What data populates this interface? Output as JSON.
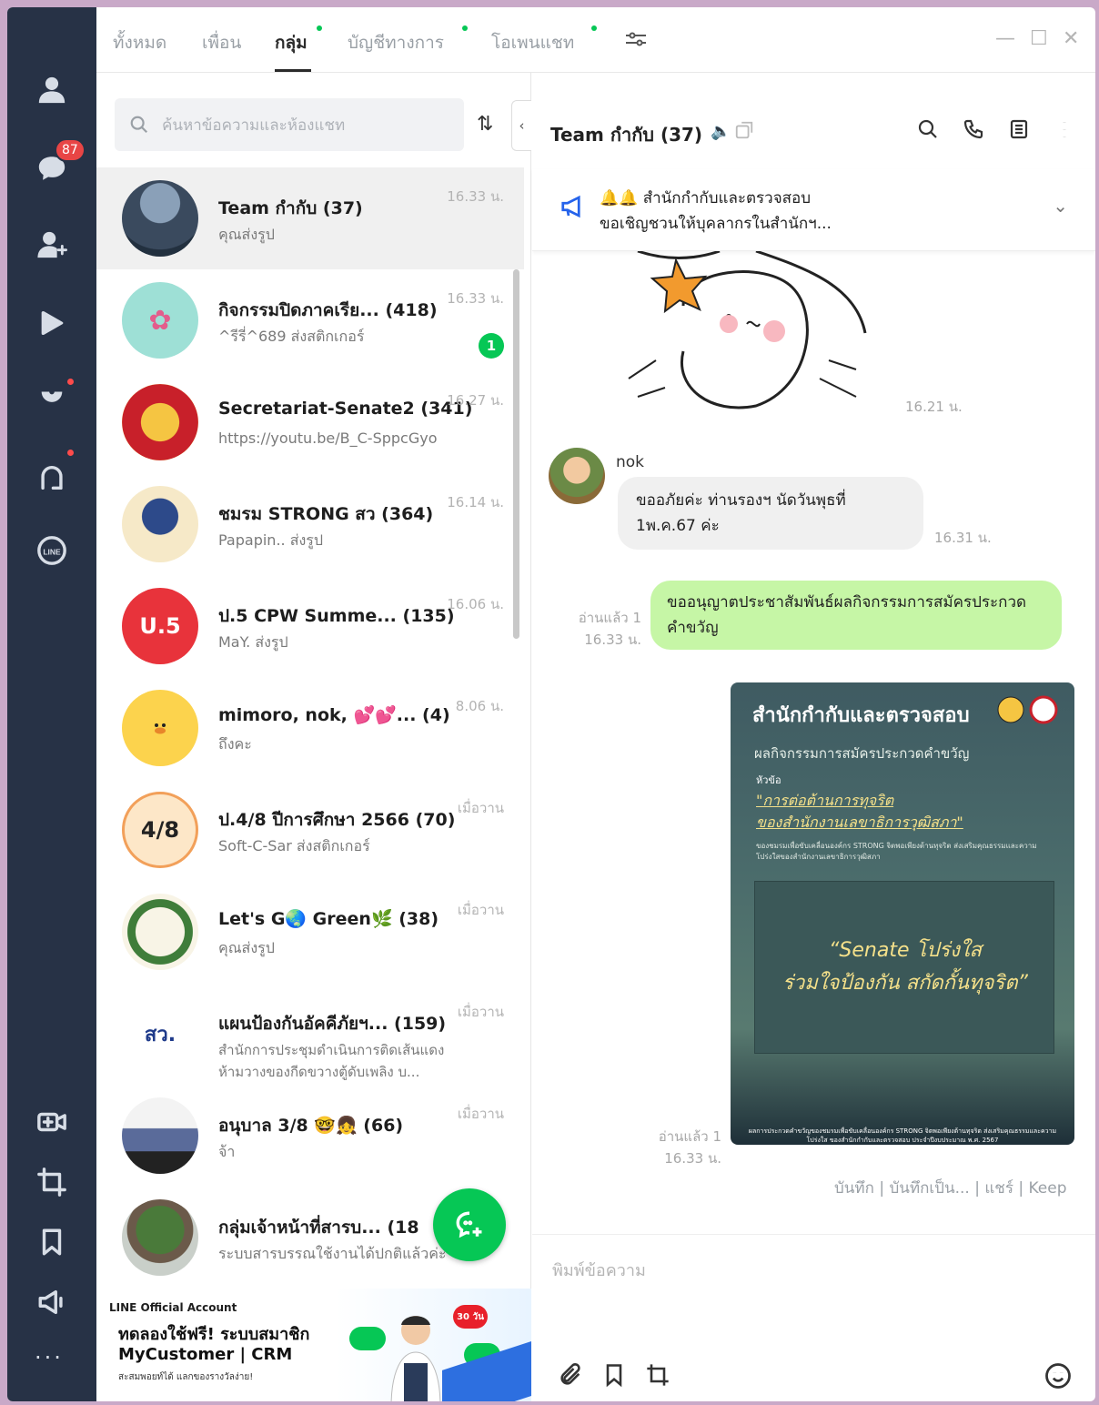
{
  "tabs": [
    {
      "label": "ทั้งหมด"
    },
    {
      "label": "เพื่อน"
    },
    {
      "label": "กลุ่ม"
    },
    {
      "label": "บัญชีทางการ"
    },
    {
      "label": "โอเพนแชท"
    }
  ],
  "nav": {
    "chat_badge": "87"
  },
  "search": {
    "placeholder": "ค้นหาข้อความและห้องแชท"
  },
  "chats": [
    {
      "name": "Team กำกับ (37)",
      "preview": "คุณส่งรูป",
      "time": "16.33 น."
    },
    {
      "name": "กิจกรรมปิดภาคเรีย... (418)",
      "preview": "^รีรี่^689 ส่งสติกเกอร์",
      "time": "16.33 น.",
      "unread": "1"
    },
    {
      "name": "Secretariat-Senate2 (341)",
      "preview": "https://youtu.be/B_C-SppcGyo",
      "time": "16.27 น."
    },
    {
      "name": "ชมรม STRONG สว (364)",
      "preview": "Papapin.. ส่งรูป",
      "time": "16.14 น."
    },
    {
      "name": "ป.5 CPW Summe... (135)",
      "preview": "MaY. ส่งรูป",
      "time": "16.06 น."
    },
    {
      "name": "mimoro, nok, 💕💕... (4)",
      "preview": "ถึงคะ",
      "time": "8.06 น."
    },
    {
      "name": "ป.4/8 ปีการศึกษา 2566 (70)",
      "preview": "Soft-C-Sar ส่งสติกเกอร์",
      "time": "เมื่อวาน"
    },
    {
      "name": "Let's G🌏 Green🌿 (38)",
      "preview": "คุณส่งรูป",
      "time": "เมื่อวาน"
    },
    {
      "name": "แผนป้องกันอัคคีภัยฯ... (159)",
      "preview": "สำนักการประชุมดำเนินการติดเส้นแดงห้ามวางของกีดขวางตู้ดับเพลิง บ...",
      "time": "เมื่อวาน"
    },
    {
      "name": "อนุบาล 3/8 🤓👧 (66)",
      "preview": "จ้า",
      "time": "เมื่อวาน"
    },
    {
      "name": "กลุ่มเจ้าหน้าที่สารบ... (18",
      "preview": "ระบบสารบรรณใช้งานได้ปกติแล้วค่ะ",
      "time": ""
    }
  ],
  "avatar_text": {
    "c4": "U.5",
    "c6": "4/8",
    "c8": "สว."
  },
  "ad": {
    "oa": "LINE Official Account",
    "title": "ทดลองใช้ฟรี! ระบบสมาชิก MyCustomer | CRM",
    "sub": "สะสมพอยท์ได้ แลกของรางวัลง่าย!",
    "badge": "30 วัน"
  },
  "room": {
    "title": "Team กำกับ (37)"
  },
  "announcement": {
    "line1": "🔔🔔 สำนักกำกับและตรวจสอบ",
    "line2": "ขอเชิญชวนให้บุคลากรในสำนักฯ..."
  },
  "messages": {
    "sticker_time": "16.21 น.",
    "sender": "nok",
    "incoming": "ขออภัยค่ะ ท่านรองฯ นัดวันพุธที่ 1พ.ค.67 ค่ะ",
    "incoming_time": "16.31 น.",
    "outgoing": "ขออนุญาตประชาสัมพันธ์ผลกิจกรรมการสมัครประกวดคำขวัญ",
    "outgoing_read": "อ่านแล้ว 1",
    "outgoing_time": "16.33 น.",
    "image_read": "อ่านแล้ว 1",
    "image_time": "16.33 น."
  },
  "poster": {
    "title": "สำนักกำกับและตรวจสอบ",
    "subtitle": "ผลกิจกรรมการสมัครประกวดคำขวัญ",
    "topic_label": "หัวข้อ",
    "topic_1": "\"การต่อต้านการทุจริต",
    "topic_2": "ของสำนักงานเลขาธิการวุฒิสภา\"",
    "small": "ของชมรมเพื่อขับเคลื่อนองค์กร STRONG จิตพอเพียงต้านทุจริต ส่งเสริมคุณธรรมและความโปร่งใสของสำนักงานเลขาธิการวุฒิสภา",
    "quote_1": "“Senate โปร่งใส",
    "quote_2": "ร่วมใจป้องกัน สกัดกั้นทุจริต”",
    "foot": "ผลการประกวดคำขวัญของชมรมเพื่อขับเคลื่อนองค์กร STRONG จิตพอเพียงต้านทุจริต ส่งเสริมคุณธรรมและความโปร่งใส ของสำนักกำกับและตรวจสอบ ประจำปีงบประมาณ พ.ศ. 2567",
    "actions": "บันทึก | บันทึกเป็น... | แชร์ | Keep"
  },
  "input": {
    "placeholder": "พิมพ์ข้อความ"
  },
  "colors": {
    "nav_bg": "#273246",
    "accent": "#06c755",
    "outgoing_bubble": "#c6f6a6",
    "badge": "#e84545"
  }
}
